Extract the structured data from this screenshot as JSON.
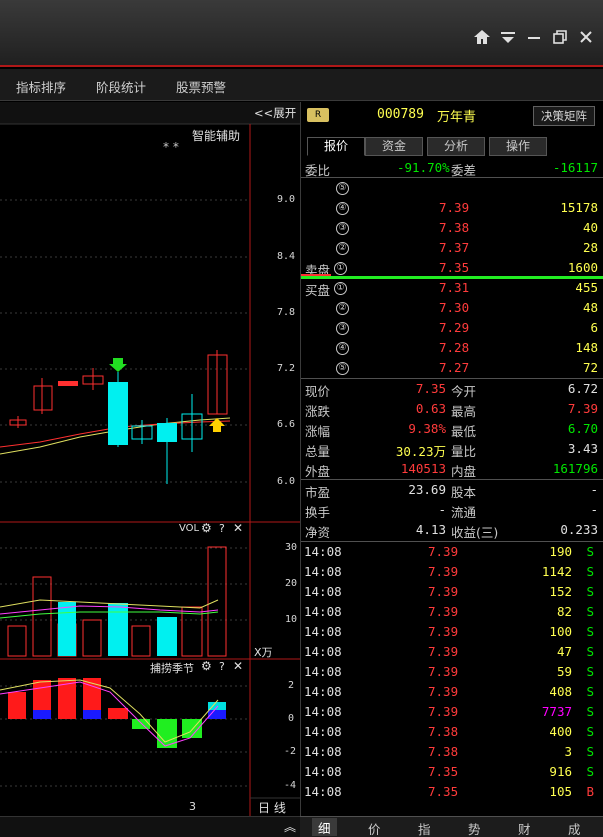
{
  "menu": [
    "指标排序",
    "阶段统计",
    "股票预警"
  ],
  "chart": {
    "expand_label": "<<展开",
    "indicator_label": "智能辅助",
    "stars": "*   *",
    "main_ticks": [
      "9.0",
      "8.4",
      "7.8",
      "7.2",
      "6.6",
      "6.0"
    ],
    "vol_label": "VOL",
    "vol_ticks": [
      "30",
      "20",
      "10"
    ],
    "vol_unit": "X万",
    "sub_label": "捕捞季节",
    "sub_ticks": [
      "2",
      "0",
      "-2",
      "-4"
    ],
    "footer_number": "3",
    "period_label": "日 线"
  },
  "stock": {
    "badge": "R",
    "code": "000789",
    "name": "万年青",
    "decision_button": "决策矩阵",
    "tabs": [
      "报价",
      "资金",
      "分析",
      "操作"
    ]
  },
  "weibi": {
    "label": "委比",
    "value": "-91.70%",
    "diff_label": "委差",
    "diff": "-16117"
  },
  "sell": [
    {
      "n": "⑤",
      "price": "",
      "vol": ""
    },
    {
      "n": "④",
      "price": "7.39",
      "vol": "15178"
    },
    {
      "n": "③",
      "price": "7.38",
      "vol": "40"
    },
    {
      "n": "②",
      "price": "7.37",
      "vol": "28"
    },
    {
      "n": "①",
      "price": "7.35",
      "vol": "1600",
      "label": "卖盘"
    }
  ],
  "buy": [
    {
      "n": "①",
      "price": "7.31",
      "vol": "455",
      "label": "买盘"
    },
    {
      "n": "②",
      "price": "7.30",
      "vol": "48"
    },
    {
      "n": "③",
      "price": "7.29",
      "vol": "6"
    },
    {
      "n": "④",
      "price": "7.28",
      "vol": "148"
    },
    {
      "n": "⑤",
      "price": "7.27",
      "vol": "72"
    }
  ],
  "stats": [
    {
      "l1": "现价",
      "v1": "7.35",
      "c1": "red",
      "l2": "今开",
      "v2": "6.72",
      "c2": "white"
    },
    {
      "l1": "涨跌",
      "v1": "0.63",
      "c1": "red",
      "l2": "最高",
      "v2": "7.39",
      "c2": "red"
    },
    {
      "l1": "涨幅",
      "v1": "9.38%",
      "c1": "red",
      "l2": "最低",
      "v2": "6.70",
      "c2": "green"
    },
    {
      "l1": "总量",
      "v1": "30.23万",
      "c1": "yellow",
      "l2": "量比",
      "v2": "3.43",
      "c2": "white"
    },
    {
      "l1": "外盘",
      "v1": "140513",
      "c1": "red",
      "l2": "内盘",
      "v2": "161796",
      "c2": "green"
    }
  ],
  "fundamentals": [
    {
      "l1": "市盈",
      "v1": "23.69",
      "l2": "股本",
      "v2": "-"
    },
    {
      "l1": "换手",
      "v1": "-",
      "l2": "流通",
      "v2": "-"
    },
    {
      "l1": "净资",
      "v1": "4.13",
      "l2": "收益(三)",
      "v2": "0.233"
    }
  ],
  "ticks": [
    {
      "time": "14:08",
      "price": "7.39",
      "pc": "red",
      "vol": "190",
      "vc": "yellow",
      "side": "S"
    },
    {
      "time": "14:08",
      "price": "7.39",
      "pc": "red",
      "vol": "1142",
      "vc": "yellow",
      "side": "S"
    },
    {
      "time": "14:08",
      "price": "7.39",
      "pc": "red",
      "vol": "152",
      "vc": "yellow",
      "side": "S"
    },
    {
      "time": "14:08",
      "price": "7.39",
      "pc": "red",
      "vol": "82",
      "vc": "yellow",
      "side": "S"
    },
    {
      "time": "14:08",
      "price": "7.39",
      "pc": "red",
      "vol": "100",
      "vc": "yellow",
      "side": "S"
    },
    {
      "time": "14:08",
      "price": "7.39",
      "pc": "red",
      "vol": "47",
      "vc": "yellow",
      "side": "S"
    },
    {
      "time": "14:08",
      "price": "7.39",
      "pc": "red",
      "vol": "59",
      "vc": "yellow",
      "side": "S"
    },
    {
      "time": "14:08",
      "price": "7.39",
      "pc": "red",
      "vol": "408",
      "vc": "yellow",
      "side": "S"
    },
    {
      "time": "14:08",
      "price": "7.39",
      "pc": "red",
      "vol": "7737",
      "vc": "magenta",
      "side": "S"
    },
    {
      "time": "14:08",
      "price": "7.38",
      "pc": "red",
      "vol": "400",
      "vc": "yellow",
      "side": "S"
    },
    {
      "time": "14:08",
      "price": "7.38",
      "pc": "red",
      "vol": "3",
      "vc": "yellow",
      "side": "S"
    },
    {
      "time": "14:08",
      "price": "7.35",
      "pc": "red",
      "vol": "916",
      "vc": "yellow",
      "side": "S"
    },
    {
      "time": "14:08",
      "price": "7.35",
      "pc": "red",
      "vol": "105",
      "vc": "yellow",
      "side": "B"
    }
  ],
  "bottom_tabs": [
    "细",
    "价",
    "指",
    "势",
    "财",
    "成"
  ]
}
